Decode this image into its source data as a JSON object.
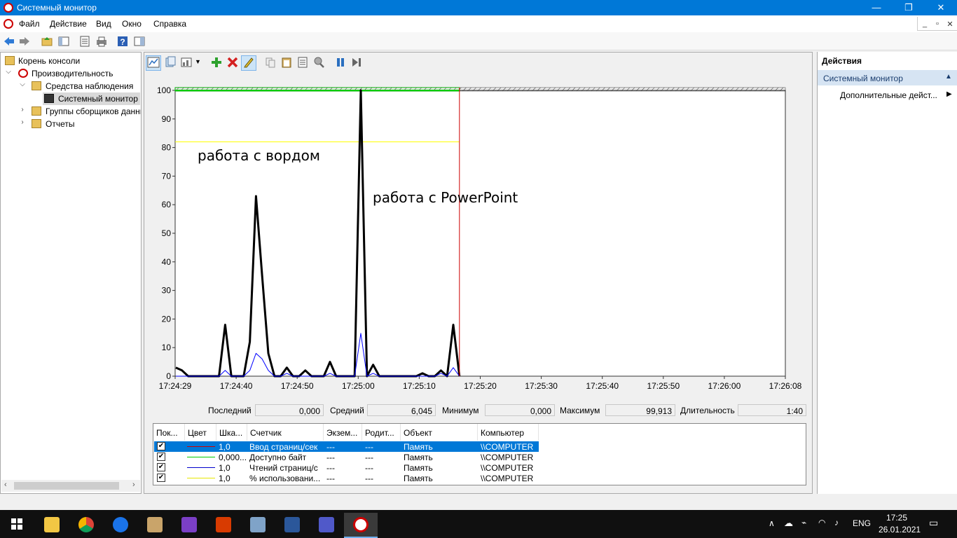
{
  "window": {
    "title": "Системный монитор",
    "minimize": "—",
    "maximize": "❐",
    "close": "✕"
  },
  "menu": {
    "items": [
      "Файл",
      "Действие",
      "Вид",
      "Окно",
      "Справка"
    ]
  },
  "tree": {
    "items": [
      {
        "label": "Корень консоли"
      },
      {
        "label": "Производительность"
      },
      {
        "label": "Средства наблюдения"
      },
      {
        "label": "Системный монитор"
      },
      {
        "label": "Группы сборщиков данных"
      },
      {
        "label": "Отчеты"
      }
    ]
  },
  "chart_data": {
    "type": "line",
    "ylim": [
      0,
      100
    ],
    "yticks": [
      "100",
      "90",
      "80",
      "70",
      "60",
      "50",
      "40",
      "30",
      "20",
      "10",
      "0"
    ],
    "xticks": [
      "17:24:29",
      "17:24:40",
      "17:24:50",
      "17:25:00",
      "17:25:10",
      "17:25:20",
      "17:25:30",
      "17:25:40",
      "17:25:50",
      "17:26:00",
      "17:26:08"
    ],
    "series": [
      {
        "name": "Ввод страниц/сек",
        "color": "#000000",
        "values": [
          3,
          2,
          0,
          0,
          0,
          0,
          0,
          0,
          18,
          0,
          0,
          0,
          12,
          63,
          35,
          8,
          0,
          0,
          3,
          0,
          0,
          2,
          0,
          0,
          0,
          5,
          0,
          0,
          0,
          0,
          100,
          0,
          4,
          0,
          0,
          0,
          0,
          0,
          0,
          0,
          1,
          0,
          0,
          2,
          0,
          18,
          0
        ]
      },
      {
        "name": "Чтений страниц/с",
        "color": "#0000ff",
        "values": [
          0,
          0,
          0,
          0,
          0,
          0,
          0,
          0,
          2,
          0,
          0,
          0,
          2,
          8,
          6,
          2,
          0,
          0,
          1,
          0,
          0,
          0,
          0,
          0,
          0,
          1,
          0,
          0,
          0,
          0,
          15,
          0,
          1,
          0,
          0,
          0,
          0,
          0,
          0,
          0,
          0,
          0,
          0,
          1,
          0,
          3,
          0
        ]
      },
      {
        "name": "% использования",
        "color": "#ffff00",
        "value": 82
      },
      {
        "name": "Доступно байт",
        "color": "#00cc00",
        "value": 100
      }
    ],
    "annotations": [
      "работа с вордом",
      "работа с PowerPoint"
    ]
  },
  "stats": {
    "last_label": "Последний",
    "last_value": "0,000",
    "avg_label": "Средний",
    "avg_value": "6,045",
    "min_label": "Минимум",
    "min_value": "0,000",
    "max_label": "Максимум",
    "max_value": "99,913",
    "dur_label": "Длительность",
    "dur_value": "1:40"
  },
  "legend": {
    "headers": [
      "Пок...",
      "Цвет",
      "Шка...",
      "Счетчик",
      "Экзем...",
      "Родит...",
      "Объект",
      "Компьютер"
    ],
    "rows": [
      {
        "color": "#cc0000",
        "scale": "1,0",
        "counter": "Ввод страниц/сек",
        "instance": "---",
        "parent": "---",
        "object": "Память",
        "computer": "\\\\COMPUTER"
      },
      {
        "color": "#00cc00",
        "scale": "0,000...",
        "counter": "Доступно байт",
        "instance": "---",
        "parent": "---",
        "object": "Память",
        "computer": "\\\\COMPUTER"
      },
      {
        "color": "#0000cc",
        "scale": "1,0",
        "counter": "Чтений страниц/с",
        "instance": "---",
        "parent": "---",
        "object": "Память",
        "computer": "\\\\COMPUTER"
      },
      {
        "color": "#e6e600",
        "scale": "1,0",
        "counter": "% использовани...",
        "instance": "---",
        "parent": "---",
        "object": "Память",
        "computer": "\\\\COMPUTER"
      }
    ]
  },
  "actions": {
    "header": "Действия",
    "section": "Системный монитор",
    "item": "Дополнительные дейст..."
  },
  "taskbar": {
    "lang": "ENG",
    "time": "17:25",
    "date": "26.01.2021"
  }
}
